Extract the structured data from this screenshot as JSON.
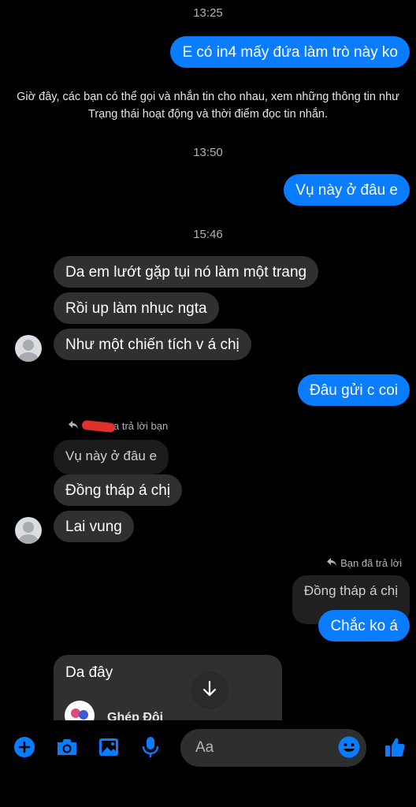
{
  "colors": {
    "accent": "#0a7cff",
    "incoming": "#303030",
    "background": "#000000"
  },
  "messages": {
    "ts1": "13:25",
    "out1": "E có in4 mấy đứa làm trò này ko",
    "system_notice": "Giờ đây, các bạn có thể gọi và nhắn tin cho nhau, xem những thông tin như Trạng thái hoạt động và thời điểm đọc tin nhắn.",
    "ts2": "13:50",
    "out2": "Vụ này ở đâu e",
    "ts3": "15:46",
    "in1": "Da em lướt gặp tụi nó làm một trang",
    "in2": "Rồi up làm nhục ngta",
    "in3": "Như một chiến tích v á chị",
    "out3": "Đâu gửi c coi",
    "reply_note_in": "a trả lời bạn",
    "quote_in": "Vụ này ở đâu e",
    "in4": "Đồng tháp á chị",
    "in5": "Lai vung",
    "reply_note_out": "Bạn đã trả lời",
    "quote_out": "Đồng tháp á chị",
    "out4": "Chắc ko á",
    "in6": "Da đây",
    "shared_title": "Ghép Đôi"
  },
  "composer": {
    "placeholder": "Aa",
    "icons": [
      "plus-icon",
      "camera-icon",
      "image-icon",
      "microphone-icon",
      "emoji-icon",
      "thumbs-up-icon"
    ]
  }
}
